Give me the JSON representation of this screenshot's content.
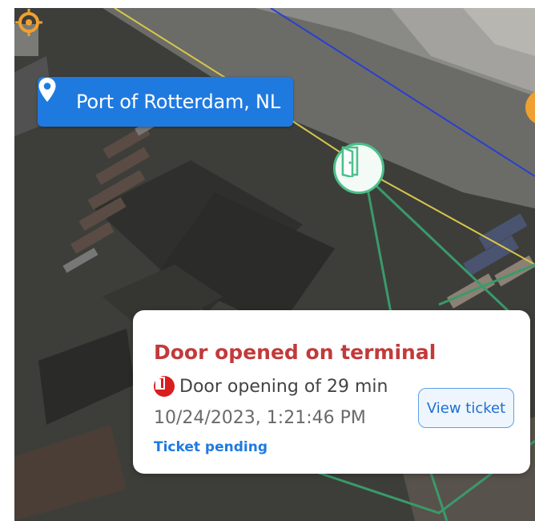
{
  "location": {
    "icon": "map-pin-icon",
    "label": "Port of Rotterdam, NL"
  },
  "map": {
    "markers": [
      {
        "icon": "door-icon",
        "color": "#4cc08a"
      },
      {
        "icon": "crosshair-target-icon",
        "color": "#f0a030"
      }
    ],
    "boundary_colors": {
      "yellow": "#d8c64a",
      "blue": "#2a3fd0",
      "green": "#3a9a6a"
    }
  },
  "alert": {
    "title": "Door opened on terminal",
    "badge_icon": "door-alert-badge-icon",
    "description": "Door opening of 29 min",
    "timestamp": "10/24/2023, 1:21:46 PM",
    "status": "Ticket pending",
    "button_label": "View ticket",
    "title_color": "#c23a3a",
    "status_color": "#1f7ae0"
  }
}
